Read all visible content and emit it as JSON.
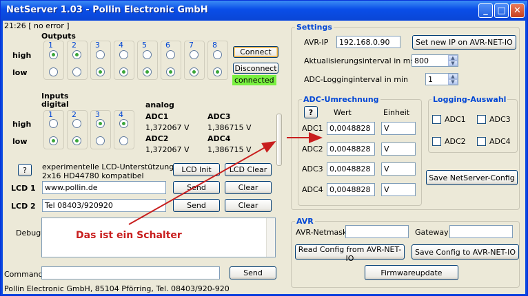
{
  "window": {
    "title": "NetServer 1.03 - Pollin Electronic GmbH",
    "status_line": "21:26 [ no error ]"
  },
  "outputs": {
    "label": "Outputs",
    "numbers": [
      "1",
      "2",
      "3",
      "4",
      "5",
      "6",
      "7",
      "8"
    ],
    "high_label": "high",
    "low_label": "low",
    "state": [
      "high",
      "high",
      "low",
      "low",
      "low",
      "low",
      "low",
      "low"
    ]
  },
  "connection": {
    "connect_label": "Connect",
    "disconnect_label": "Disconnect",
    "status": "connected"
  },
  "inputs": {
    "label": "Inputs",
    "sublabel": "digital",
    "numbers": [
      "1",
      "2",
      "3",
      "4"
    ],
    "high_label": "high",
    "low_label": "low",
    "state": [
      "low",
      "low",
      "high",
      "high"
    ],
    "analog_label": "analog",
    "adc": [
      {
        "name": "ADC1",
        "value": "1,372067 V"
      },
      {
        "name": "ADC3",
        "value": "1,386715 V"
      },
      {
        "name": "ADC2",
        "value": "1,372067 V"
      },
      {
        "name": "ADC4",
        "value": "1,386715 V"
      }
    ]
  },
  "lcd": {
    "help_label": "?",
    "info_line1": "experimentelle LCD-Unterstützung",
    "info_line2": "2x16 HD44780 kompatibel",
    "init_label": "LCD Init",
    "clear_all_label": "LCD Clear",
    "lcd1_label": "LCD 1",
    "lcd1_value": "www.pollin.de",
    "lcd2_label": "LCD 2",
    "lcd2_value": "Tel 08403/920920",
    "send_label": "Send",
    "clear_label": "Clear"
  },
  "debug": {
    "label": "Debug",
    "annotation": "Das ist ein Schalter"
  },
  "command": {
    "label": "Command",
    "value": "",
    "send_label": "Send"
  },
  "footer": "Pollin Electronic GmbH, 85104 Pförring, Tel. 08403/920-920",
  "settings": {
    "title": "Settings",
    "ip_label": "AVR-IP",
    "ip_value": "192.168.0.90",
    "set_ip_label": "Set new IP on AVR-NET-IO",
    "update_label": "Aktualisierungsinterval in ms",
    "update_value": "800",
    "logging_interval_label": "ADC-Logginginterval in min",
    "logging_interval_value": "1",
    "adc_conv": {
      "title": "ADC-Umrechnung",
      "help_label": "?",
      "col_value": "Wert",
      "col_unit": "Einheit",
      "rows": [
        {
          "name": "ADC1",
          "value": "0,0048828",
          "unit": "V"
        },
        {
          "name": "ADC2",
          "value": "0,0048828",
          "unit": "V"
        },
        {
          "name": "ADC3",
          "value": "0,0048828",
          "unit": "V"
        },
        {
          "name": "ADC4",
          "value": "0,0048828",
          "unit": "V"
        }
      ]
    },
    "logging": {
      "title": "Logging-Auswahl",
      "items": [
        "ADC1",
        "ADC3",
        "ADC2",
        "ADC4"
      ]
    },
    "save_label": "Save NetServer-Config"
  },
  "avr": {
    "title": "AVR",
    "netmask_label": "AVR-Netmask",
    "netmask_value": "",
    "gateway_label": "Gateway",
    "gateway_value": "",
    "read_label": "Read Config from AVR-NET-IO",
    "save_label": "Save Config to AVR-NET-IO",
    "firmware_label": "Firmwareupdate"
  },
  "colors": {
    "annotation": "#c81e1e",
    "group_title": "#0046d5",
    "status_ok": "#79f040"
  }
}
